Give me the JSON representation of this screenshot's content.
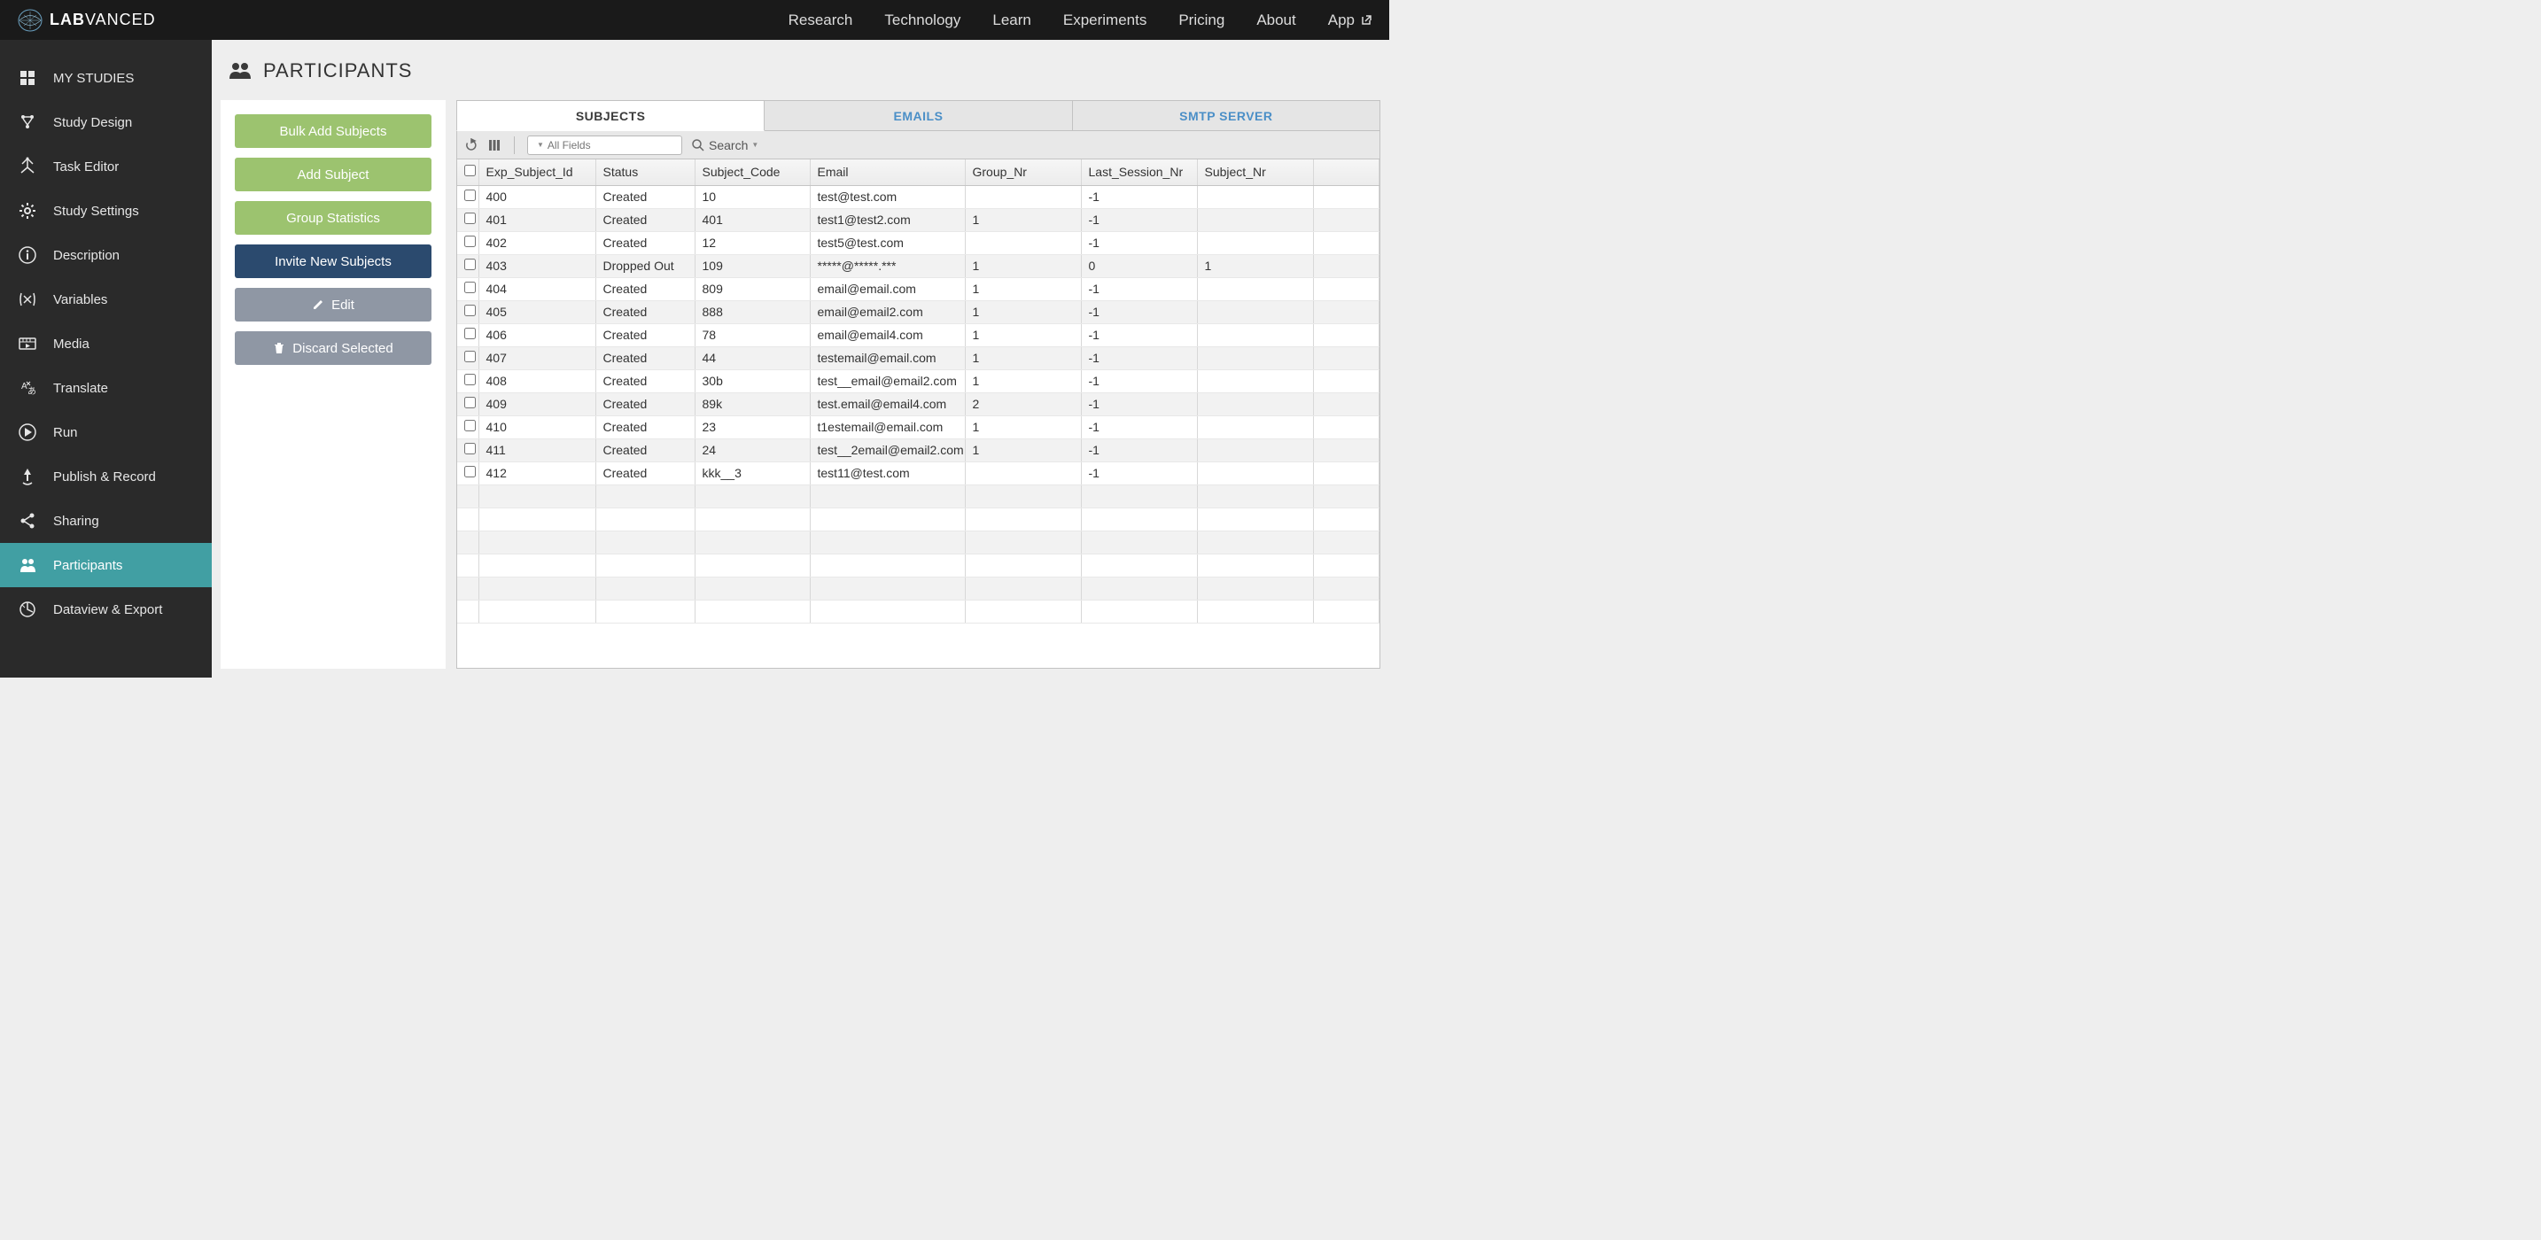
{
  "brand": {
    "bold": "LAB",
    "rest": "VANCED"
  },
  "topnav": [
    "Research",
    "Technology",
    "Learn",
    "Experiments",
    "Pricing",
    "About",
    "App"
  ],
  "sidebar": [
    {
      "label": "MY STUDIES",
      "icon": "studies"
    },
    {
      "label": "Study Design",
      "icon": "design"
    },
    {
      "label": "Task Editor",
      "icon": "task"
    },
    {
      "label": "Study Settings",
      "icon": "settings"
    },
    {
      "label": "Description",
      "icon": "info"
    },
    {
      "label": "Variables",
      "icon": "variables"
    },
    {
      "label": "Media",
      "icon": "media"
    },
    {
      "label": "Translate",
      "icon": "translate"
    },
    {
      "label": "Run",
      "icon": "run"
    },
    {
      "label": "Publish & Record",
      "icon": "publish"
    },
    {
      "label": "Sharing",
      "icon": "share"
    },
    {
      "label": "Participants",
      "icon": "participants",
      "active": true
    },
    {
      "label": "Dataview & Export",
      "icon": "data"
    }
  ],
  "page_title": "PARTICIPANTS",
  "actions": {
    "bulk_add": "Bulk Add Subjects",
    "add": "Add Subject",
    "group_stats": "Group Statistics",
    "invite": "Invite New Subjects",
    "edit": "Edit",
    "discard": "Discard Selected"
  },
  "tabs": [
    {
      "label": "SUBJECTS",
      "active": true
    },
    {
      "label": "EMAILS"
    },
    {
      "label": "SMTP SERVER"
    }
  ],
  "search": {
    "placeholder": "All Fields",
    "label": "Search"
  },
  "columns": [
    "Exp_Subject_Id",
    "Status",
    "Subject_Code",
    "Email",
    "Group_Nr",
    "Last_Session_Nr",
    "Subject_Nr"
  ],
  "rows": [
    {
      "id": "400",
      "status": "Created",
      "code": "10",
      "email": "test@test.com",
      "group": "",
      "last": "-1",
      "subj": ""
    },
    {
      "id": "401",
      "status": "Created",
      "code": "401",
      "email": "test1@test2.com",
      "group": "1",
      "last": "-1",
      "subj": ""
    },
    {
      "id": "402",
      "status": "Created",
      "code": "12",
      "email": "test5@test.com",
      "group": "",
      "last": "-1",
      "subj": ""
    },
    {
      "id": "403",
      "status": "Dropped Out",
      "code": "109",
      "email": "*****@*****.***",
      "group": "1",
      "last": "0",
      "subj": "1"
    },
    {
      "id": "404",
      "status": "Created",
      "code": "809",
      "email": "email@email.com",
      "group": "1",
      "last": "-1",
      "subj": ""
    },
    {
      "id": "405",
      "status": "Created",
      "code": "888",
      "email": "email@email2.com",
      "group": "1",
      "last": "-1",
      "subj": ""
    },
    {
      "id": "406",
      "status": "Created",
      "code": "78",
      "email": "email@email4.com",
      "group": "1",
      "last": "-1",
      "subj": ""
    },
    {
      "id": "407",
      "status": "Created",
      "code": "44",
      "email": "testemail@email.com",
      "group": "1",
      "last": "-1",
      "subj": ""
    },
    {
      "id": "408",
      "status": "Created",
      "code": "30b",
      "email": "test__email@email2.com",
      "group": "1",
      "last": "-1",
      "subj": ""
    },
    {
      "id": "409",
      "status": "Created",
      "code": "89k",
      "email": "test.email@email4.com",
      "group": "2",
      "last": "-1",
      "subj": ""
    },
    {
      "id": "410",
      "status": "Created",
      "code": "23",
      "email": "t1estemail@email.com",
      "group": "1",
      "last": "-1",
      "subj": ""
    },
    {
      "id": "411",
      "status": "Created",
      "code": "24",
      "email": "test__2email@email2.com",
      "group": "1",
      "last": "-1",
      "subj": ""
    },
    {
      "id": "412",
      "status": "Created",
      "code": "kkk__3",
      "email": "test11@test.com",
      "group": "",
      "last": "-1",
      "subj": ""
    }
  ],
  "empty_rows": 6
}
